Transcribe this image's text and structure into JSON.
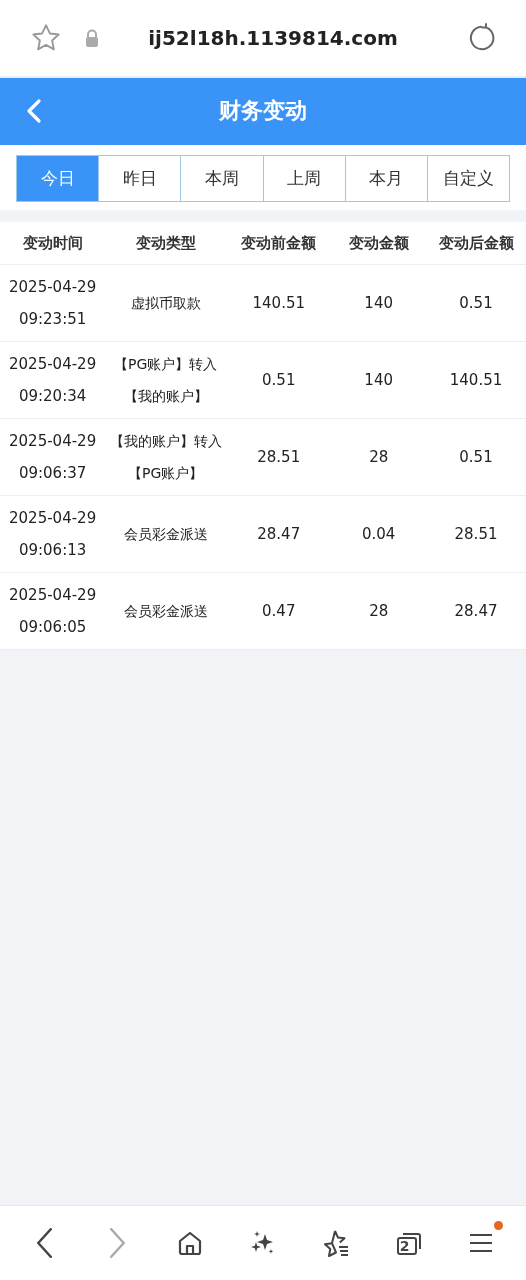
{
  "address_bar": {
    "url": "ij52l18h.1139814.com",
    "secure": true
  },
  "header": {
    "title": "财务变动"
  },
  "tabs": [
    {
      "label": "今日",
      "selected": true
    },
    {
      "label": "昨日",
      "selected": false
    },
    {
      "label": "本周",
      "selected": false
    },
    {
      "label": "上周",
      "selected": false
    },
    {
      "label": "本月",
      "selected": false
    },
    {
      "label": "自定义",
      "selected": false
    }
  ],
  "table": {
    "columns": [
      "变动时间",
      "变动类型",
      "变动前金额",
      "变动金额",
      "变动后金额"
    ],
    "rows": [
      {
        "date": "2025-04-29",
        "time": "09:23:51",
        "type": "虚拟币取款",
        "before": "140.51",
        "amount": "140",
        "after": "0.51"
      },
      {
        "date": "2025-04-29",
        "time": "09:20:34",
        "type": "【PG账户】转入【我的账户】",
        "before": "0.51",
        "amount": "140",
        "after": "140.51"
      },
      {
        "date": "2025-04-29",
        "time": "09:06:37",
        "type": "【我的账户】转入【PG账户】",
        "before": "28.51",
        "amount": "28",
        "after": "0.51"
      },
      {
        "date": "2025-04-29",
        "time": "09:06:13",
        "type": "会员彩金派送",
        "before": "28.47",
        "amount": "0.04",
        "after": "28.51"
      },
      {
        "date": "2025-04-29",
        "time": "09:06:05",
        "type": "会员彩金派送",
        "before": "0.47",
        "amount": "28",
        "after": "28.47"
      }
    ]
  },
  "bottom_bar": [
    {
      "kind": "back",
      "disabled": false
    },
    {
      "kind": "forward",
      "disabled": true
    },
    {
      "kind": "home",
      "disabled": false
    },
    {
      "kind": "sparkle",
      "disabled": false
    },
    {
      "kind": "bookmarks",
      "disabled": false
    },
    {
      "kind": "tabs",
      "count": "2",
      "disabled": false
    },
    {
      "kind": "menu",
      "notification": true,
      "disabled": false
    }
  ]
}
